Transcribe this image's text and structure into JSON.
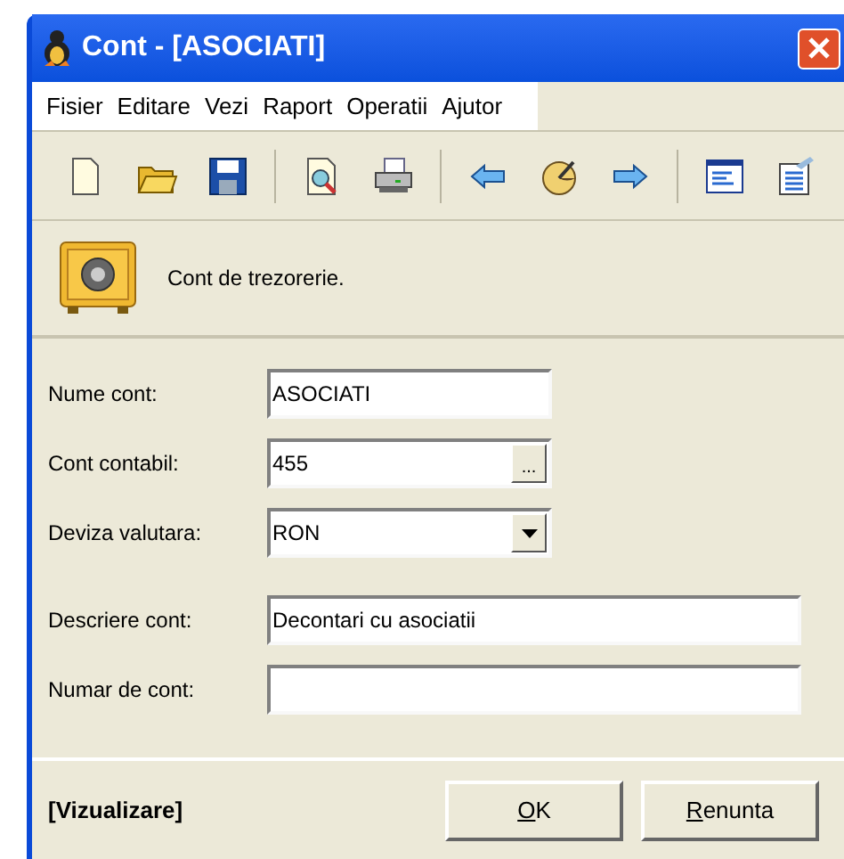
{
  "window": {
    "title": "Cont - [ASOCIATI]"
  },
  "menu": [
    "Fisier",
    "Editare",
    "Vezi",
    "Raport",
    "Operatii",
    "Ajutor"
  ],
  "toolbar": [
    {
      "kind": "new"
    },
    {
      "kind": "open"
    },
    {
      "kind": "save"
    },
    {
      "kind": "sep"
    },
    {
      "kind": "preview"
    },
    {
      "kind": "print"
    },
    {
      "kind": "sep"
    },
    {
      "kind": "back"
    },
    {
      "kind": "gauge"
    },
    {
      "kind": "forward"
    },
    {
      "kind": "sep"
    },
    {
      "kind": "list"
    },
    {
      "kind": "properties"
    }
  ],
  "header": {
    "text": "Cont de trezorerie."
  },
  "fields": [
    {
      "label": "Nume cont:",
      "value": "ASOCIATI",
      "kind": "text",
      "wide": false
    },
    {
      "label": "Cont contabil:",
      "value": "455",
      "kind": "browse",
      "wide": false
    },
    {
      "label": "Deviza valutara:",
      "value": "RON",
      "kind": "select",
      "wide": false
    },
    {
      "label": "Descriere cont:",
      "value": "Decontari cu asociatii",
      "kind": "text",
      "wide": true,
      "gap": true
    },
    {
      "label": "Numar de cont:",
      "kind": "text",
      "wide": true
    }
  ],
  "browse_button": "...",
  "status": "[Vizualizare]",
  "buttons": [
    "OK",
    "Renunta"
  ]
}
